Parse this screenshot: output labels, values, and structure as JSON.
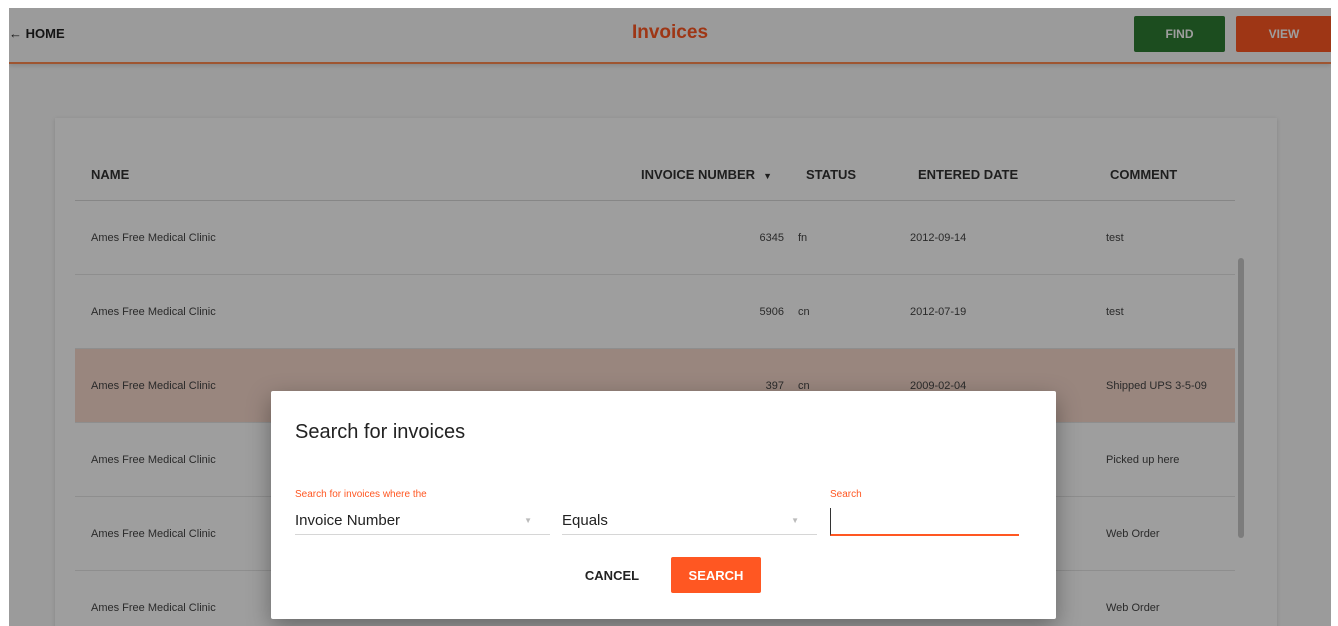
{
  "header": {
    "home_label": "← HOME",
    "title": "Invoices",
    "find_label": "FIND",
    "view_label": "VIEW"
  },
  "colors": {
    "accent": "#ff5722",
    "find_button": "#2e7d32",
    "selected_row": "#f7d8cc"
  },
  "table": {
    "columns": [
      "NAME",
      "INVOICE NUMBER",
      "STATUS",
      "ENTERED DATE",
      "COMMENT"
    ],
    "sort_icon": "arrow-down-icon",
    "rows": [
      {
        "name": "Ames Free Medical Clinic",
        "invoice": "6345",
        "status": "fn",
        "date": "2012-09-14",
        "comment": "test"
      },
      {
        "name": "Ames Free Medical Clinic",
        "invoice": "5906",
        "status": "cn",
        "date": "2012-07-19",
        "comment": "test"
      },
      {
        "name": "Ames Free Medical Clinic",
        "invoice": "397",
        "status": "cn",
        "date": "2009-02-04",
        "comment": "Shipped UPS 3-5-09"
      },
      {
        "name": "Ames Free Medical Clinic",
        "invoice": "",
        "status": "",
        "date": "",
        "comment": "Picked up here"
      },
      {
        "name": "Ames Free Medical Clinic",
        "invoice": "",
        "status": "",
        "date": "",
        "comment": "Web Order"
      },
      {
        "name": "Ames Free Medical Clinic",
        "invoice": "",
        "status": "",
        "date": "",
        "comment": "Web Order"
      }
    ]
  },
  "dialog": {
    "title": "Search for invoices",
    "where_label": "Search for invoices where the",
    "field_value": "Invoice Number",
    "operator_value": "Equals",
    "search_label": "Search",
    "search_value": "",
    "cancel_label": "CANCEL",
    "search_button": "SEARCH"
  }
}
